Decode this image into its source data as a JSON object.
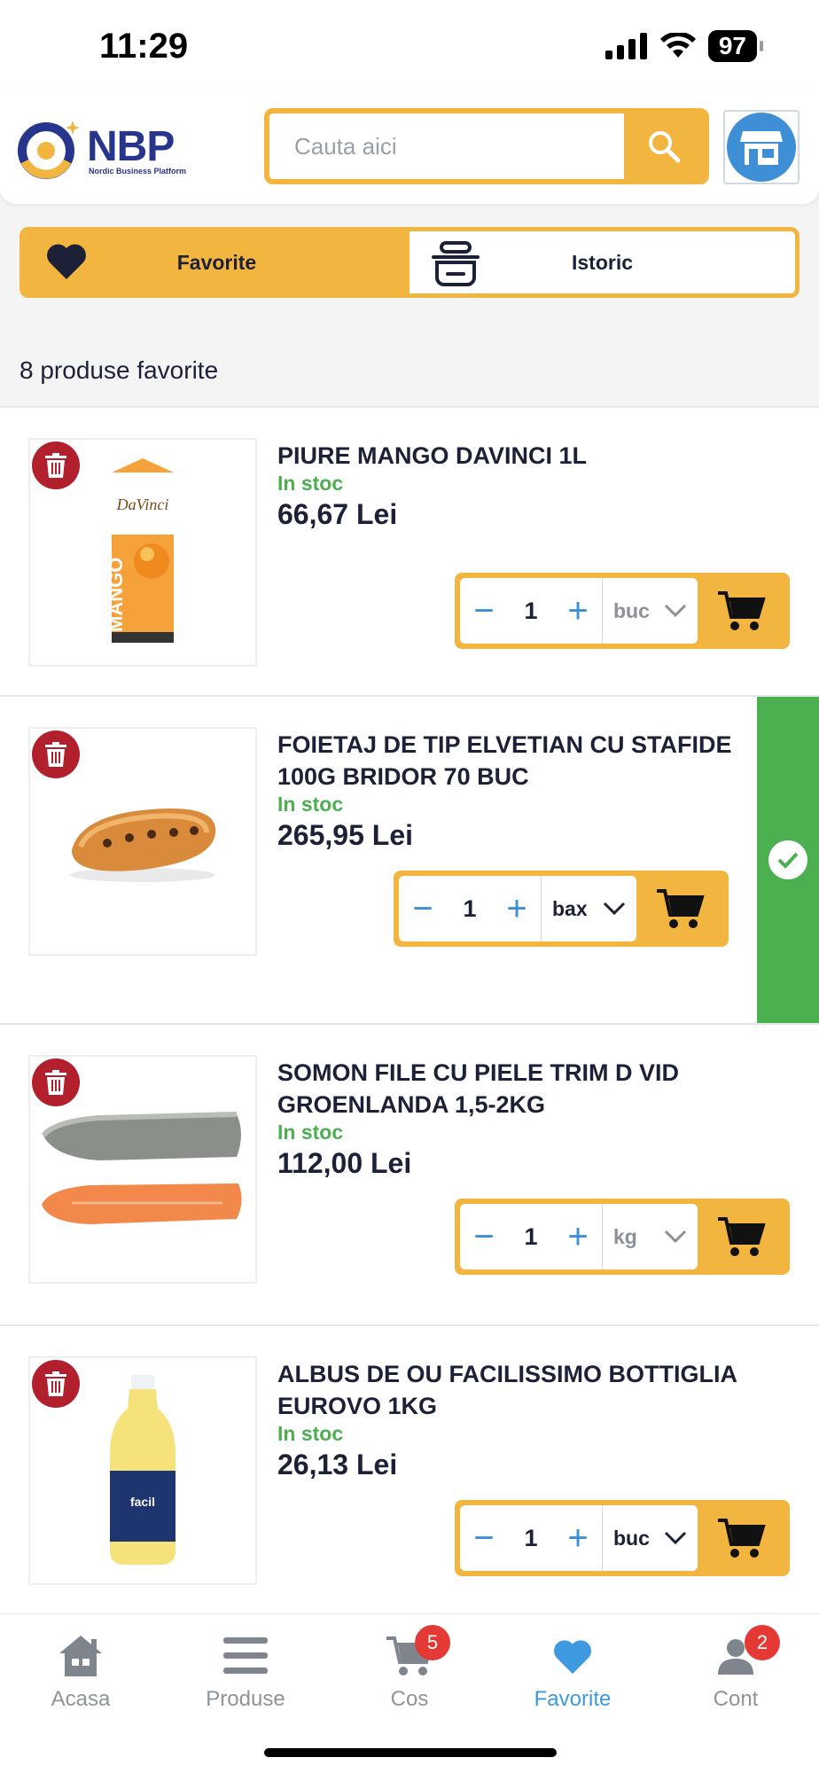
{
  "status_bar": {
    "time": "11:29",
    "battery": "97"
  },
  "header": {
    "logo_text": "NBP",
    "logo_subtitle": "Nordic Business Platform",
    "search_placeholder": "Cauta aici"
  },
  "tabs": [
    {
      "label": "Favorite",
      "active": true
    },
    {
      "label": "Istoric",
      "active": false
    }
  ],
  "favorites_count_label": "8 produse favorite",
  "products": [
    {
      "name": "PIURE MANGO DAVINCI 1L",
      "stock": "In stoc",
      "price": "66,67 Lei",
      "qty": "1",
      "unit": "buc",
      "added": false,
      "image": "mango-puree-carton"
    },
    {
      "name": "FOIETAJ DE TIP ELVETIAN CU STAFIDE 100G BRIDOR 70 BUC",
      "stock": "In stoc",
      "price": "265,95 Lei",
      "qty": "1",
      "unit": "bax",
      "added": true,
      "image": "raisin-pastry"
    },
    {
      "name": "SOMON FILE CU PIELE TRIM D VID GROENLANDA 1,5-2KG",
      "stock": "In stoc",
      "price": "112,00 Lei",
      "qty": "1",
      "unit": "kg",
      "added": false,
      "image": "salmon-fillet"
    },
    {
      "name": "ALBUS DE OU FACILISSIMO BOTTIGLIA EUROVO 1KG",
      "stock": "In stoc",
      "price": "26,13 Lei",
      "qty": "1",
      "unit": "buc",
      "added": false,
      "image": "egg-white-bottle"
    }
  ],
  "bottom_nav": [
    {
      "label": "Acasa",
      "icon": "home-icon",
      "badge": ""
    },
    {
      "label": "Produse",
      "icon": "menu-icon",
      "badge": ""
    },
    {
      "label": "Cos",
      "icon": "cart-icon",
      "badge": "5"
    },
    {
      "label": "Favorite",
      "icon": "heart-icon",
      "badge": "",
      "active": true
    },
    {
      "label": "Cont",
      "icon": "user-icon",
      "badge": "2"
    }
  ],
  "colors": {
    "accent": "#f2b640",
    "brand_blue": "#27358c",
    "in_stock": "#4caf50",
    "delete": "#b1202c",
    "active_nav": "#3d9ae0"
  }
}
